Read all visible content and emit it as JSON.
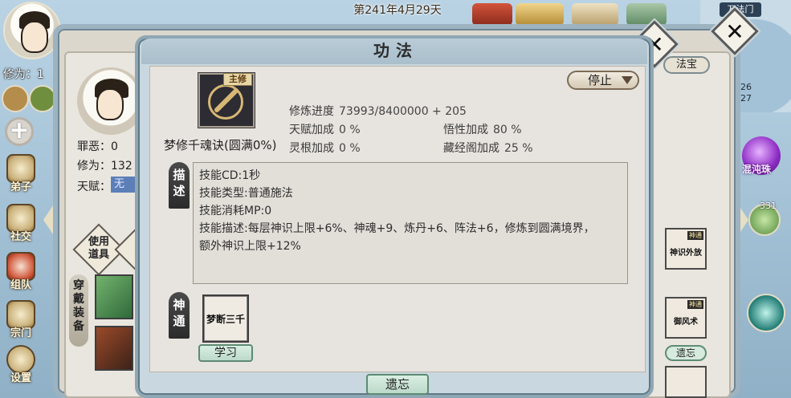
{
  "header": {
    "date": "第241年4月29天"
  },
  "player": {
    "xiuwei_label": "修为：1",
    "stats": {
      "sin_label": "罪恶：",
      "sin_value": "0",
      "xiuwei_label": "修为：",
      "xiuwei_value": "132",
      "talent_label": "天赋：",
      "talent_value": "无"
    },
    "use_item_label": "使用道具",
    "equip_label": "穿戴装备"
  },
  "sidebar": {
    "items": [
      {
        "label": "弟子",
        "icon": "disciple-icon"
      },
      {
        "label": "社交",
        "icon": "social-icon"
      },
      {
        "label": "组队",
        "icon": "team-icon"
      },
      {
        "label": "宗门",
        "icon": "sect-icon"
      },
      {
        "label": "设置",
        "icon": "settings-icon"
      }
    ]
  },
  "right_panel": {
    "tab_label": "法宝",
    "skills": [
      {
        "tag": "神通",
        "name": "神识外放"
      },
      {
        "tag": "神通",
        "name": "御风术"
      }
    ],
    "forget_label": "遗忘"
  },
  "minimap": {
    "name": "万法门",
    "value_a": "26",
    "value_b": "27"
  },
  "orb": {
    "label": "混沌珠",
    "count": "331"
  },
  "dialog": {
    "title": "功法",
    "main_tag": "主修",
    "skill_name": "梦修千魂诀(圆满0%)",
    "stop_button": "停止",
    "progress": {
      "label": "修炼进度",
      "value": "73993/8400000 + 205"
    },
    "bonuses": [
      {
        "label": "天赋加成",
        "value": "0 %"
      },
      {
        "label": "悟性加成",
        "value": "80 %"
      },
      {
        "label": "灵根加成",
        "value": "0 %"
      },
      {
        "label": "藏经阁加成",
        "value": "25 %"
      }
    ],
    "desc_title": "描述",
    "description": [
      "技能CD:1秒",
      "技能类型:普通施法",
      "技能消耗MP:0",
      "技能描述:每层神识上限+6%、神魂+9、炼丹+6、阵法+6，修炼到圆满境界，",
      "额外神识上限+12%"
    ],
    "shentong_title": "神通",
    "shentong_skill": "梦断三千",
    "learn_button": "学习",
    "forget_button": "遗忘"
  },
  "colors": {
    "dialog_frame": "#8fa7b4",
    "panel_bg": "#e7e4df",
    "button_green": "#bcd9c9",
    "talent_badge": "#5d7fb8"
  }
}
